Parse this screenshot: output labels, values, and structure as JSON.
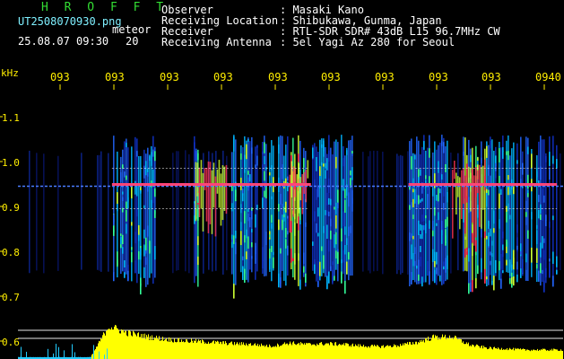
{
  "header": {
    "brand": "H R O F F T",
    "filename": "UT2508070930.png",
    "tag": "meteor",
    "datetime": "25.08.07 09:30",
    "interval": "20"
  },
  "info": {
    "labels": [
      "Observer",
      "Receiving Location",
      "Receiver",
      "Receiving Antenna"
    ],
    "values": [
      ": Masaki Kano",
      ": Shibukawa, Gunma, Japan",
      ": RTL-SDR SDR# 43dB L15 96.7MHz CW",
      ": 5el Yagi Az 280 for Seoul"
    ]
  },
  "colors": {
    "background": "#000000",
    "axis_text": "#ffee00",
    "power_trace": "#ffff00",
    "low_trace": "#22ccff",
    "brand": "#33dd33"
  },
  "chart_data": {
    "type": "heatmap",
    "ylabel": "kHz",
    "y_ticks": [
      "1.1",
      "1.0",
      "0.9",
      "0.8",
      "0.7",
      "0.6"
    ],
    "ylim": [
      0.58,
      1.2
    ],
    "x_ticks": [
      "093",
      "093",
      "093",
      "093",
      "093",
      "093",
      "093",
      "093",
      "093",
      "0940"
    ],
    "carrier_khz": 0.945,
    "signal_band_khz": [
      0.76,
      1.01
    ],
    "activity_bands_minute_index": [
      [
        5.2,
        7.6
      ],
      [
        9.7,
        10.0
      ],
      [
        11.8,
        13.2
      ],
      [
        13.3,
        15.9
      ],
      [
        16.0,
        18.5
      ],
      [
        21.6,
        23.8
      ],
      [
        24.5,
        29.8
      ]
    ],
    "strong_echo_bands_minute_index": [
      [
        9.8,
        11.5
      ],
      [
        15.0,
        16.0
      ],
      [
        24.0,
        25.8
      ]
    ],
    "power_trace_levels": [
      0.05,
      0.05,
      0.05,
      0.05,
      0.05,
      0.9,
      0.72,
      0.62,
      0.55,
      0.5,
      0.48,
      0.45,
      0.42,
      0.4,
      0.35,
      0.44,
      0.4,
      0.42,
      0.4,
      0.36,
      0.34,
      0.37,
      0.45,
      0.6,
      0.6,
      0.38,
      0.3,
      0.28,
      0.25,
      0.25
    ]
  }
}
